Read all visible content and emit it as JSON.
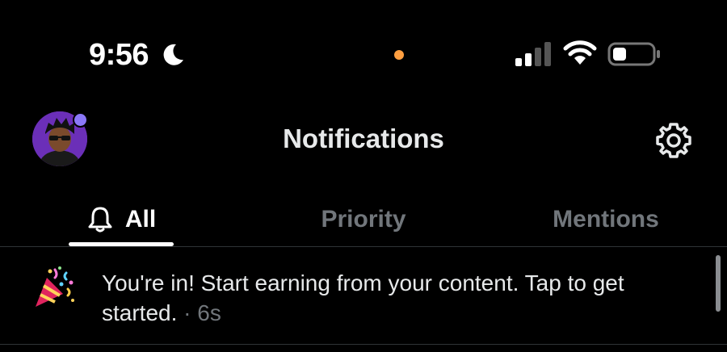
{
  "status_bar": {
    "time": "9:56",
    "icons": [
      "moon-icon",
      "mic-indicator-dot",
      "signal-icon",
      "wifi-icon",
      "battery-icon"
    ],
    "battery_level": 0.3
  },
  "header": {
    "title": "Notifications",
    "avatar_icon": "user-avatar",
    "settings_icon": "gear-icon"
  },
  "tabs": [
    {
      "label": "All",
      "icon": "bell-icon",
      "active": true
    },
    {
      "label": "Priority",
      "active": false
    },
    {
      "label": "Mentions",
      "active": false
    }
  ],
  "notifications": [
    {
      "icon": "party-popper-icon",
      "text": "You're in! Start earning from your content. Tap to get started.",
      "separator": " · ",
      "time": "6s"
    }
  ],
  "colors": {
    "background": "#000000",
    "text_primary": "#e7e9ea",
    "text_secondary": "#71767b",
    "divider": "#2f3336",
    "mic_dot": "#ff9f40",
    "avatar_badge": "#8b78f8"
  }
}
